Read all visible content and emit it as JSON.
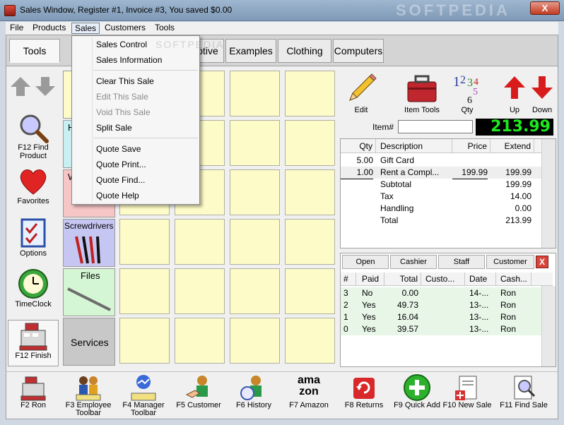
{
  "window": {
    "title": "Sales Window,  Register #1,  Invoice #3, You saved $0.00",
    "watermark": "SOFTPEDIA",
    "close_label": "X"
  },
  "menubar": {
    "items": [
      "File",
      "Products",
      "Sales",
      "Customers",
      "Tools"
    ]
  },
  "tabs": {
    "items": [
      "Tools",
      "otive",
      "Examples",
      "Clothing",
      "Computers"
    ]
  },
  "lefttools": {
    "find": "F12 Find Product",
    "favorites": "Favorites",
    "options": "Options",
    "timeclock": "TimeClock",
    "finish": "F12 Finish"
  },
  "categories": {
    "h": "H",
    "w": "W",
    "screwdrivers": "Screwdrivers",
    "files": "Files",
    "services": "Services"
  },
  "righttools": {
    "edit": "Edit",
    "item_tools": "Item Tools",
    "qty": "Qty",
    "up": "Up",
    "down": "Down"
  },
  "item": {
    "label": "Item#",
    "value": "",
    "total_display": "213.99"
  },
  "sale": {
    "headers": [
      "Qty",
      "Description",
      "Price",
      "Extend"
    ],
    "rows": [
      {
        "qty": "5.00",
        "desc": "Gift Card",
        "price": "",
        "extend": ""
      },
      {
        "qty": "1.00",
        "desc": "Rent a Compl...",
        "price": "199.99",
        "extend": "199.99"
      }
    ],
    "subtotal_label": "Subtotal",
    "subtotal": "199.99",
    "tax_label": "Tax",
    "tax": "14.00",
    "handling_label": "Handling",
    "handling": "0.00",
    "total_label": "Total",
    "total": "213.99"
  },
  "customers": {
    "buttons": [
      "Open",
      "Cashier",
      "Staff",
      "Customer"
    ],
    "close": "X",
    "headers": [
      "#",
      "Paid",
      "Total",
      "Custo...",
      "Date",
      "Cash..."
    ],
    "rows": [
      {
        "num": "3",
        "paid": "No",
        "total": "0.00",
        "cust": "",
        "date": "14-...",
        "cash": "Ron"
      },
      {
        "num": "2",
        "paid": "Yes",
        "total": "49.73",
        "cust": "",
        "date": "13-...",
        "cash": "Ron"
      },
      {
        "num": "1",
        "paid": "Yes",
        "total": "16.04",
        "cust": "",
        "date": "13-...",
        "cash": "Ron"
      },
      {
        "num": "0",
        "paid": "Yes",
        "total": "39.57",
        "cust": "",
        "date": "13-...",
        "cash": "Ron"
      }
    ]
  },
  "bottombar": {
    "items": [
      "F2 Ron",
      "F3 Employee Toolbar",
      "F4 Manager Toolbar",
      "F5 Customer",
      "F6 History",
      "F7 Amazon",
      "F8 Returns",
      "F9 Quick Add",
      "F10 New Sale",
      "F11 Find Sale"
    ],
    "amazon_logo": "ama zon"
  },
  "sales_menu": {
    "items": [
      "Sales Control",
      "Sales Information",
      "Clear This Sale",
      "Edit This Sale",
      "Void This Sale",
      "Split Sale",
      "Quote Save",
      "Quote Print...",
      "Quote Find...",
      "Quote Help"
    ],
    "watermark": "SOFTPEDIA"
  },
  "colors": {
    "cell_yellow": "#fdfbc7",
    "total_green": "#1ee81e",
    "cat_cyan": "#c8f0f3",
    "cat_pink": "#f6c6c6",
    "cat_blue": "#c6c6f3",
    "cat_green": "#d4f6d4",
    "cat_gray": "#c8c8c8"
  }
}
